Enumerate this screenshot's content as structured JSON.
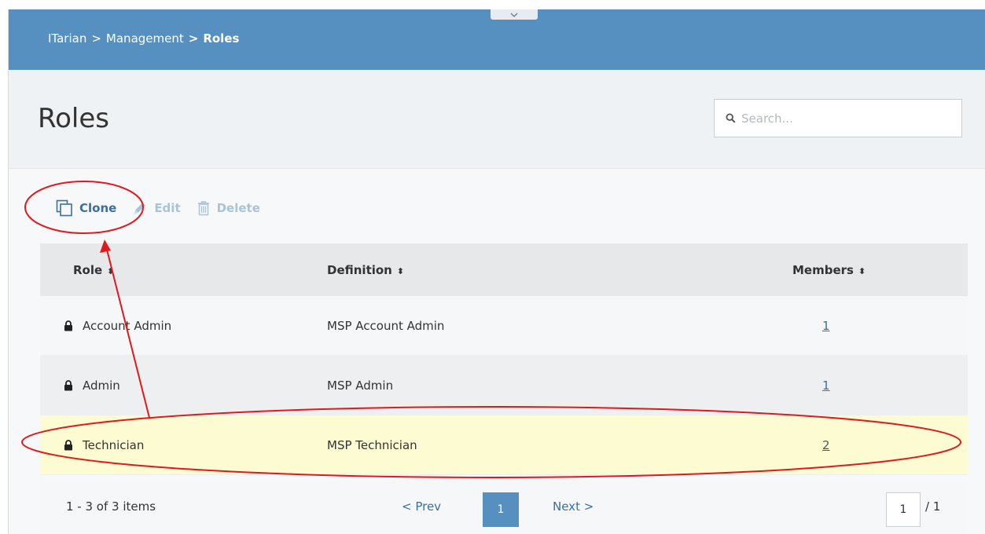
{
  "breadcrumb": {
    "items": [
      "ITarian",
      "Management"
    ],
    "separator": ">",
    "current": "Roles"
  },
  "page": {
    "title": "Roles"
  },
  "search": {
    "placeholder": "Search..."
  },
  "toolbar": {
    "clone_label": "Clone",
    "edit_label": "Edit",
    "delete_label": "Delete"
  },
  "table": {
    "headers": {
      "role": "Role",
      "definition": "Definition",
      "members": "Members"
    },
    "sort_glyph": "⬍",
    "rows": [
      {
        "role": "Account Admin",
        "definition": "MSP Account Admin",
        "members": "1"
      },
      {
        "role": "Admin",
        "definition": "MSP Admin",
        "members": "1"
      },
      {
        "role": "Technician",
        "definition": "MSP Technician",
        "members": "2"
      }
    ]
  },
  "pager": {
    "summary": "1 - 3 of 3 items",
    "prev_label": "< Prev",
    "current_page": "1",
    "next_label": "Next >",
    "page_input_value": "1",
    "total_pages": "/ 1"
  },
  "colors": {
    "header_bar": "#5590c1",
    "accent": "#3a6fa0",
    "selected_row": "#fdfbd2",
    "annotation": "#e0191c"
  }
}
